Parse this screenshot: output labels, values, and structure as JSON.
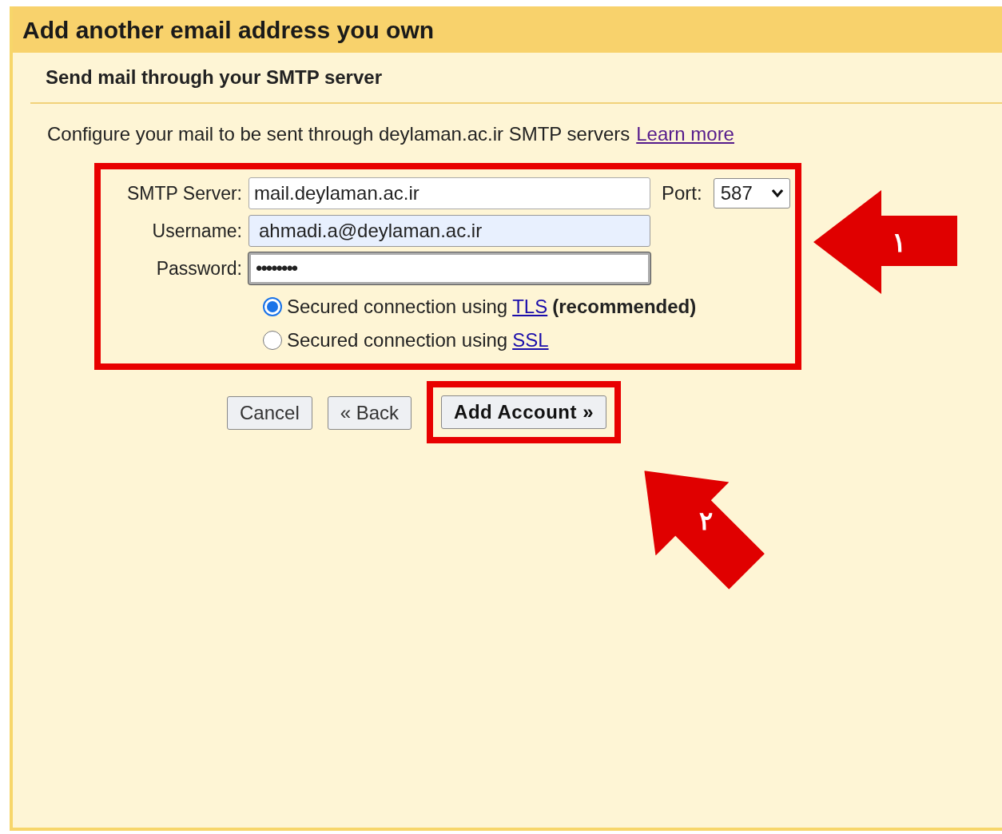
{
  "title": "Add another email address you own",
  "subtitle": "Send mail through your SMTP server",
  "description": {
    "text": "Configure your mail to be sent through deylaman.ac.ir SMTP servers",
    "link": "Learn more"
  },
  "fields": [
    {
      "label": "SMTP Server:",
      "value": "mail.deylaman.ac.ir",
      "autofilled": false,
      "focused": false
    },
    {
      "label": "Username:",
      "value": "ahmadi.a@deylaman.ac.ir",
      "autofilled": true,
      "focused": false
    },
    {
      "label": "Password:",
      "value": "••••••••",
      "autofilled": false,
      "focused": true
    }
  ],
  "port": {
    "label": "Port:",
    "value": "587"
  },
  "security_options": [
    {
      "label": "Secured connection using",
      "link": "TLS",
      "note": "(recommended)",
      "selected": true
    },
    {
      "label": "Secured connection using",
      "link": "SSL",
      "selected": false
    }
  ],
  "buttons": [
    {
      "label": "Cancel",
      "primary": false
    },
    {
      "label": "« Back",
      "primary": false
    },
    {
      "label": "Add Account »",
      "primary": true
    }
  ],
  "annotations": [
    {
      "label": "۱"
    },
    {
      "label": "۲"
    }
  ]
}
